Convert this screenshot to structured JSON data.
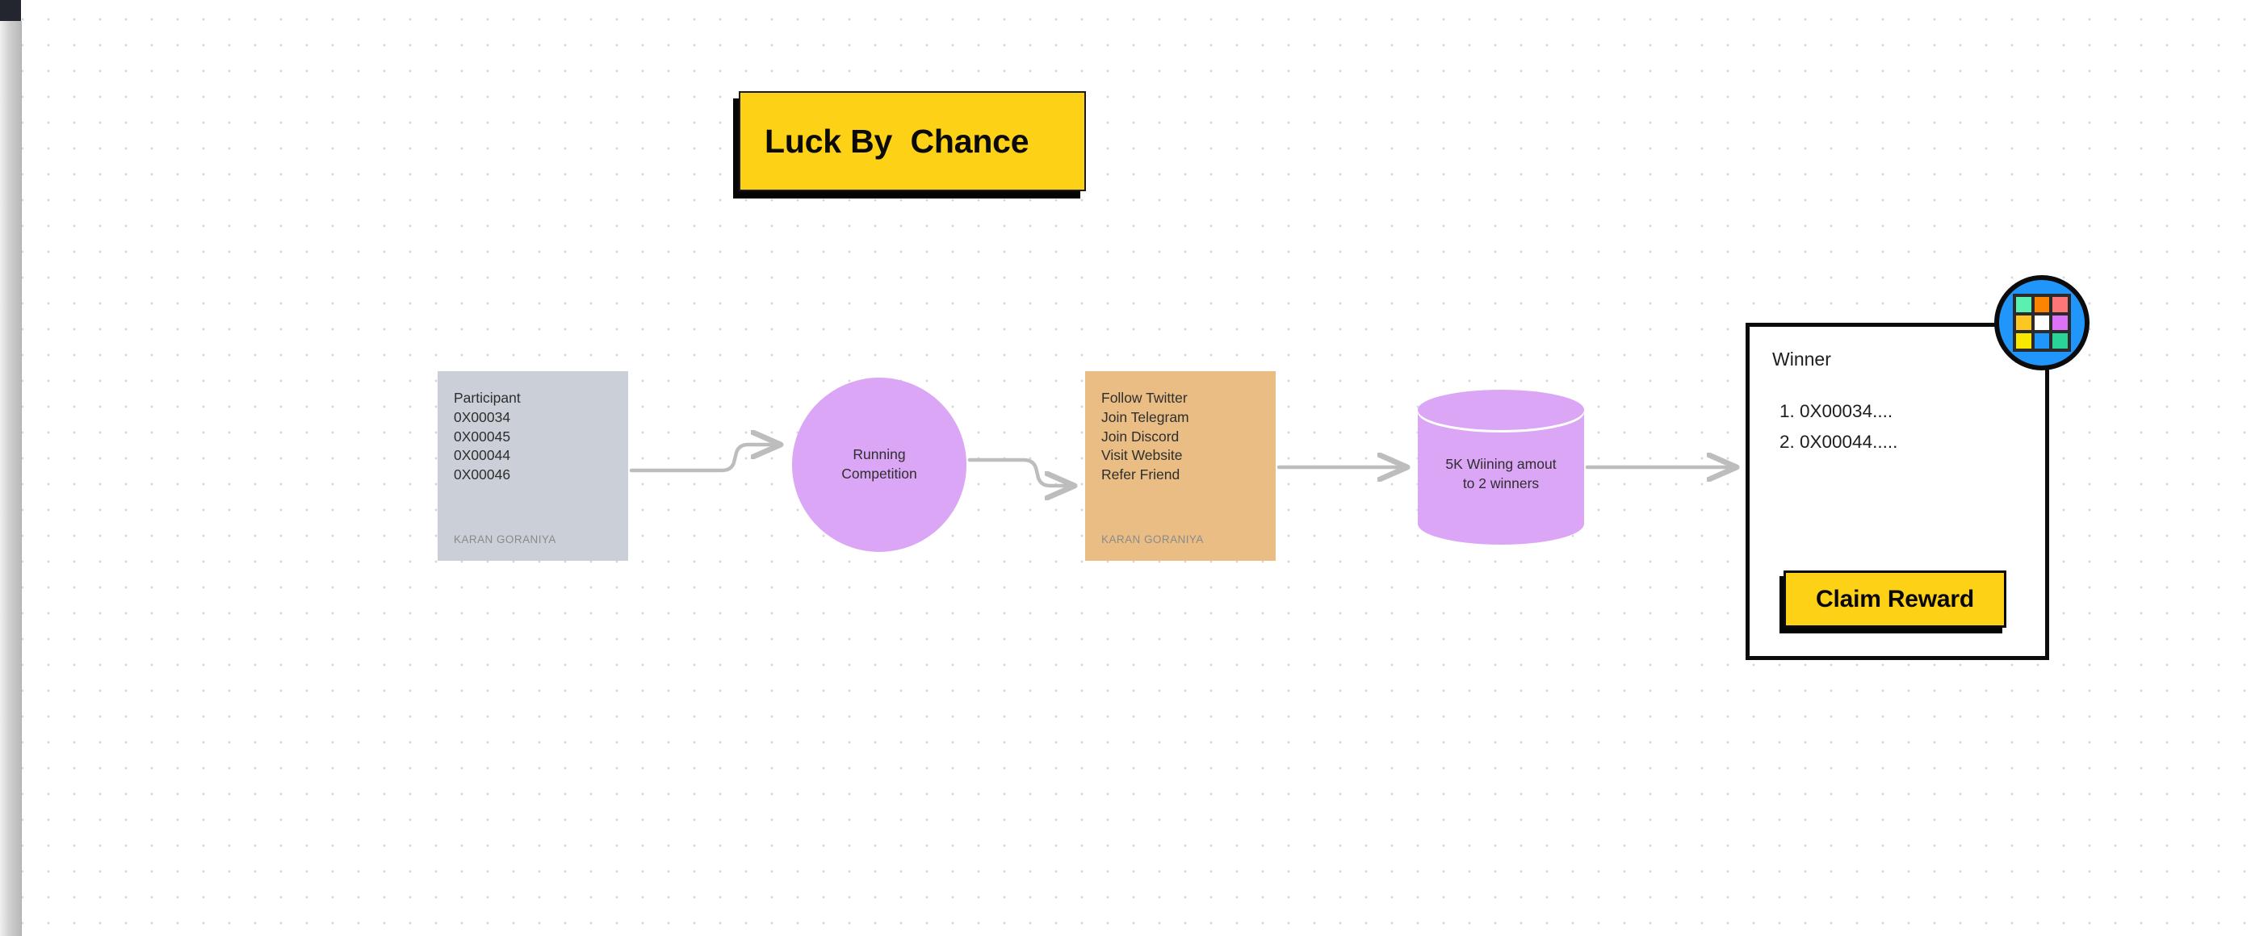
{
  "canvas": {
    "title_card": {
      "label": "Luck By  Chance",
      "bg": "#fcd116"
    },
    "grid_dot_color": "#d9d9dd"
  },
  "nodes": {
    "participants": {
      "name": "participants-sticky",
      "bg": "#cbd0d8",
      "heading": "Participant",
      "addresses": [
        "0X00034",
        "0X00045",
        "0X00044",
        "0X00046"
      ],
      "author": "KARAN GORANIYA"
    },
    "competition": {
      "name": "running-competition-circle",
      "bg": "#dca6f7",
      "line1": "Running",
      "line2": "Competition"
    },
    "tasks": {
      "name": "tasks-sticky",
      "bg": "#e9bd84",
      "items": [
        "Follow Twitter",
        "Join Telegram",
        "Join Discord",
        "Visit Website",
        "Refer Friend"
      ],
      "author": "KARAN GORANIYA"
    },
    "prize": {
      "name": "prize-cylinder",
      "bg": "#dca6f7",
      "line1": "5K Wiining amout",
      "line2": "to 2 winners"
    },
    "winner": {
      "name": "winner-panel",
      "title": "Winner",
      "winners": [
        "0X00034....",
        "0X00044....."
      ],
      "claim_label": "Claim Reward",
      "claim_bg": "#fcd116"
    }
  },
  "badge": {
    "name": "grid-badge-icon",
    "circle_color": "#2196fa",
    "cells": [
      "#5cf0b0",
      "#fc8401",
      "#fc7775",
      "#fdc723",
      "#ffffff",
      "#dc72f7",
      "#fae700",
      "#2196fa",
      "#2ad397"
    ]
  },
  "connectors": {
    "color": "#bdbdbd",
    "count": 4
  },
  "chrome": {
    "corner_color": "#24262f",
    "scrollbar_name": "vertical-scrollbar"
  }
}
